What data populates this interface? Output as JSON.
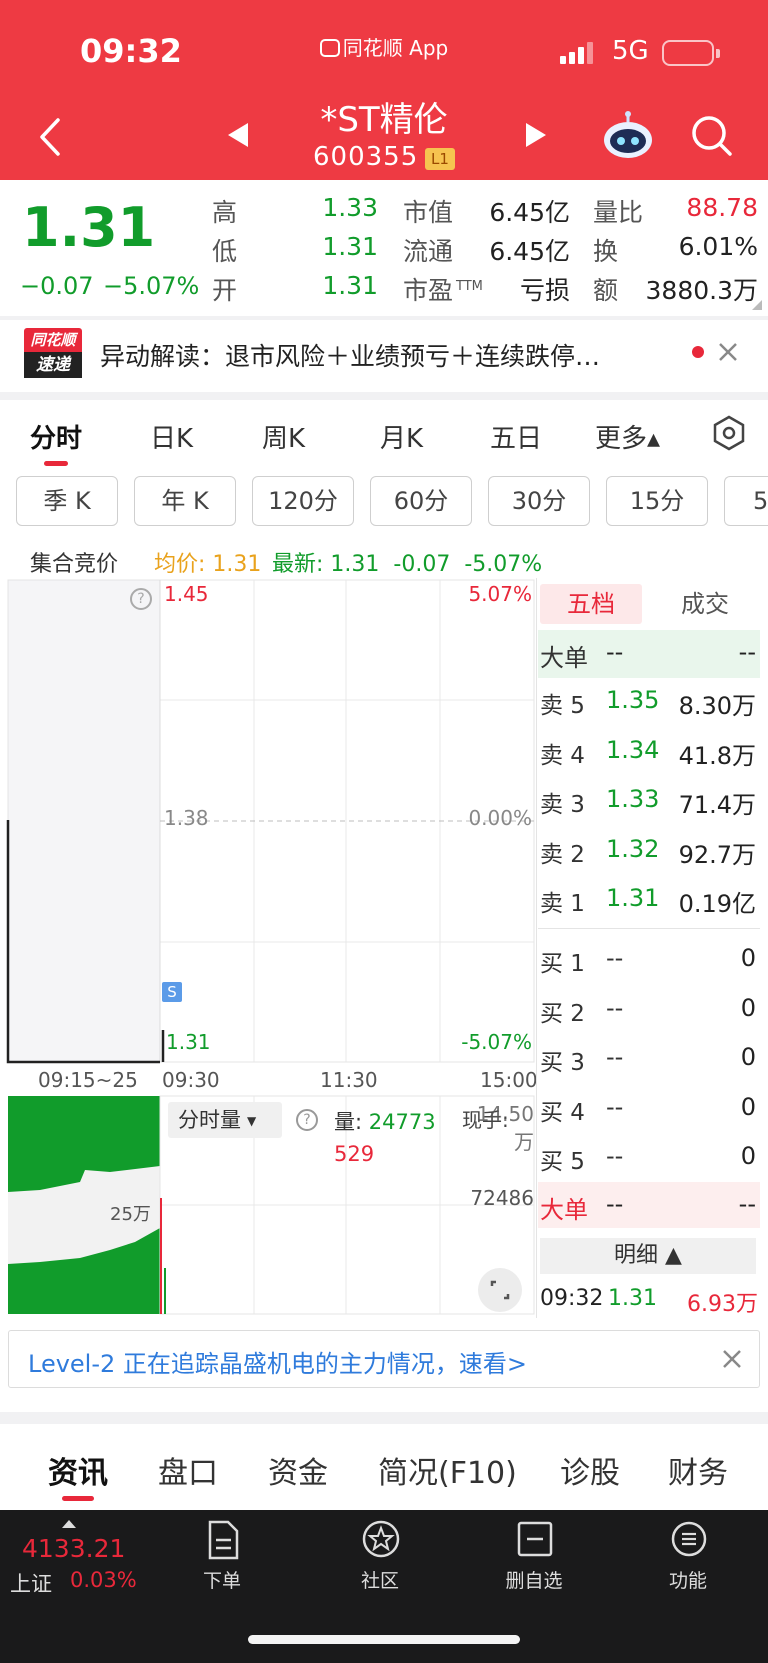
{
  "status_bar": {
    "time": "09:32",
    "app_name": "同花顺 App",
    "network": "5G"
  },
  "header": {
    "title": "*ST精伦",
    "code": "600355",
    "badge": "L1"
  },
  "quote": {
    "price": "1.31",
    "change": "−0.07",
    "change_pct": "−5.07%",
    "high_label": "高",
    "high": "1.33",
    "low_label": "低",
    "low": "1.31",
    "open_label": "开",
    "open": "1.31",
    "mktcap_label": "市值",
    "mktcap": "6.45亿",
    "float_label": "流通",
    "float": "6.45亿",
    "pe_label": "市盈",
    "pe_sup": "TTM",
    "pe": "亏损",
    "vr_label": "量比",
    "vr": "88.78",
    "turnover_label": "换",
    "turnover": "6.01%",
    "amount_label": "额",
    "amount": "3880.3万"
  },
  "news": {
    "logo_top": "同花顺",
    "logo_bottom": "速递",
    "text": "异动解读：退市风险＋业绩预亏＋连续跌停…"
  },
  "period_tabs": [
    "分时",
    "日K",
    "周K",
    "月K",
    "五日",
    "更多▴"
  ],
  "period_pills": [
    "季 K",
    "年 K",
    "120分",
    "60分",
    "30分",
    "15分",
    "5"
  ],
  "info_bar": {
    "label": "集合竞价",
    "avg_label": "均价:",
    "avg": "1.31",
    "latest_label": "最新:",
    "latest": "1.31",
    "chg": "-0.07",
    "chgp": "-5.07%"
  },
  "chart": {
    "y_top": "1.45",
    "y_mid": "1.38",
    "y_bot": "1.31",
    "pct_top": "5.07%",
    "pct_mid": "0.00%",
    "pct_bot": "-5.07%",
    "x_auction": "09:15~25",
    "x_open": "09:30",
    "x_mid": "11:30",
    "x_close": "15:00",
    "marker": "S",
    "vol_selector": "分时量",
    "vol_label": "量:",
    "vol_value": "24773",
    "vol_value2": "529",
    "vol_hand": "现手:",
    "vol_top": "14.50万",
    "vol_mid": "72486",
    "vol_auction_mid": "25万"
  },
  "order_book": {
    "tabs": [
      "五档",
      "成交"
    ],
    "big_label": "大单",
    "big_price": "--",
    "big_vol": "--",
    "asks": [
      {
        "label": "卖 5",
        "price": "1.35",
        "vol": "8.30万"
      },
      {
        "label": "卖 4",
        "price": "1.34",
        "vol": "41.8万"
      },
      {
        "label": "卖 3",
        "price": "1.33",
        "vol": "71.4万"
      },
      {
        "label": "卖 2",
        "price": "1.32",
        "vol": "92.7万"
      },
      {
        "label": "卖 1",
        "price": "1.31",
        "vol": "0.19亿"
      }
    ],
    "bids": [
      {
        "label": "买 1",
        "price": "--",
        "vol": "0"
      },
      {
        "label": "买 2",
        "price": "--",
        "vol": "0"
      },
      {
        "label": "买 3",
        "price": "--",
        "vol": "0"
      },
      {
        "label": "买 4",
        "price": "--",
        "vol": "0"
      },
      {
        "label": "买 5",
        "price": "--",
        "vol": "0"
      }
    ],
    "big2_label": "大单",
    "big2_price": "--",
    "big2_vol": "--",
    "detail_label": "明细 ▲",
    "trade_time": "09:32",
    "trade_price": "1.31",
    "trade_vol": "6.93万"
  },
  "level2_banner": "Level-2 正在追踪晶盛机电的主力情况，速看>",
  "bottom_tabs": [
    "资讯",
    "盘口",
    "资金",
    "简况(F10)",
    "诊股",
    "财务"
  ],
  "bottom_nav": {
    "index_value": "4133.21",
    "index_name": "上证",
    "index_pct": "0.03%",
    "items": [
      "下单",
      "社区",
      "删自选",
      "功能"
    ]
  },
  "colors": {
    "header_red": "#ee3a43",
    "up_red": "#e8283a",
    "down_green": "#119c2b"
  }
}
